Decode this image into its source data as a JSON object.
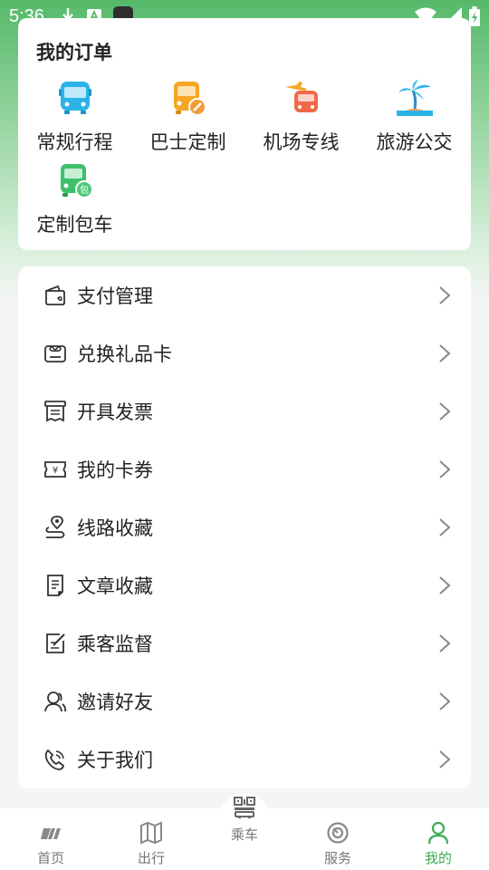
{
  "status_bar": {
    "time": "5:36"
  },
  "orders": {
    "title": "我的订单",
    "items": [
      {
        "label": "常规行程",
        "icon": "bus-icon"
      },
      {
        "label": "巴士定制",
        "icon": "custom-bus-icon"
      },
      {
        "label": "机场专线",
        "icon": "airport-shuttle-icon"
      },
      {
        "label": "旅游公交",
        "icon": "palm-tree-icon"
      },
      {
        "label": "定制包车",
        "icon": "charter-bus-icon"
      }
    ]
  },
  "menu": {
    "items": [
      {
        "label": "支付管理",
        "icon": "wallet-icon"
      },
      {
        "label": "兑换礼品卡",
        "icon": "gift-card-icon"
      },
      {
        "label": "开具发票",
        "icon": "invoice-icon"
      },
      {
        "label": "我的卡券",
        "icon": "coupon-icon"
      },
      {
        "label": "线路收藏",
        "icon": "route-pin-icon"
      },
      {
        "label": "文章收藏",
        "icon": "article-icon"
      },
      {
        "label": "乘客监督",
        "icon": "supervise-edit-icon"
      },
      {
        "label": "邀请好友",
        "icon": "invite-friend-icon"
      },
      {
        "label": "关于我们",
        "icon": "about-phone-icon"
      }
    ]
  },
  "tabbar": {
    "items": [
      {
        "label": "首页",
        "icon": "home-logo-icon",
        "active": false
      },
      {
        "label": "出行",
        "icon": "map-icon",
        "active": false
      },
      {
        "label": "乘车",
        "icon": "qr-bus-icon",
        "active": false
      },
      {
        "label": "服务",
        "icon": "service-icon",
        "active": false
      },
      {
        "label": "我的",
        "icon": "profile-icon",
        "active": true
      }
    ]
  },
  "colors": {
    "brand_green": "#3daa55",
    "header_green": "#56b96a",
    "icon_blue": "#2bb3e8",
    "icon_orange": "#f5a623",
    "icon_red": "#f06a4a",
    "icon_green": "#3ec06a"
  }
}
